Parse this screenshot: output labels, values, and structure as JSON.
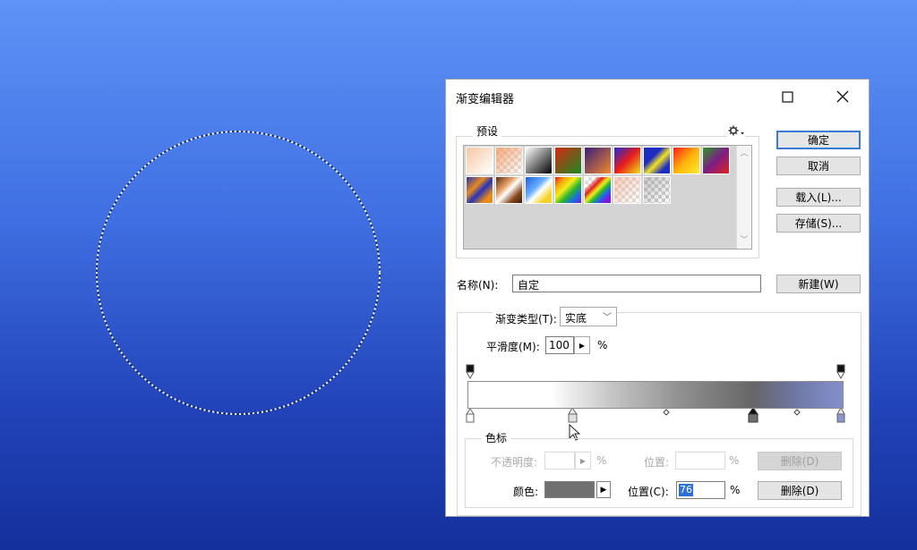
{
  "dialog": {
    "title": "渐变编辑器",
    "presets_label": "预设",
    "name_label": "名称(N):",
    "name_value": "自定",
    "buttons": {
      "ok": "确定",
      "cancel": "取消",
      "load": "载入(L)...",
      "save": "存储(S)...",
      "new": "新建(W)"
    },
    "gradient_type_label": "渐变类型(T):",
    "gradient_type_value": "实底",
    "smoothness_label": "平滑度(M):",
    "smoothness_value": "100",
    "percent": "%",
    "stops_group_label": "色标",
    "opacity_label": "不透明度:",
    "opacity_location_label": "位置:",
    "opacity_delete": "删除(D)",
    "color_label": "颜色:",
    "color_value": "#707070",
    "location_label": "位置(C):",
    "location_value": "76",
    "color_delete": "删除(D)"
  },
  "colors": {
    "accent": "#3d7ad6",
    "selected_text_bg": "#2f6fd8"
  },
  "icons": [
    "maximize-icon",
    "close-icon",
    "gear-icon",
    "scroll-up-icon",
    "scroll-down-icon",
    "triangle-right-icon",
    "mouse-cursor-icon"
  ]
}
